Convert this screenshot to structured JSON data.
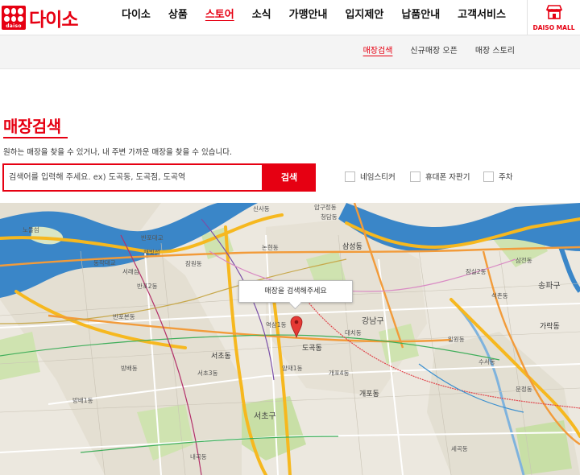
{
  "header": {
    "logo_text": "다이소",
    "logo_small": "daiso",
    "nav": [
      {
        "label": "다이소",
        "active": false
      },
      {
        "label": "상품",
        "active": false
      },
      {
        "label": "스토어",
        "active": true
      },
      {
        "label": "소식",
        "active": false
      },
      {
        "label": "가맹안내",
        "active": false
      },
      {
        "label": "입지제안",
        "active": false
      },
      {
        "label": "납품안내",
        "active": false
      },
      {
        "label": "고객서비스",
        "active": false
      }
    ],
    "mall_label": "DAISO MALL"
  },
  "subnav": [
    {
      "label": "매장검색",
      "active": true
    },
    {
      "label": "신규매장 오픈",
      "active": false
    },
    {
      "label": "매장 스토리",
      "active": false
    }
  ],
  "main": {
    "title": "매장검색",
    "description": "원하는 매장을 찾을 수 있거나, 내 주변 가까운 매장을 찾을 수 있습니다.",
    "search_placeholder": "검색어를 입력해 주세요. ex) 도곡동, 도곡점, 도곡역",
    "search_button": "검색",
    "filters": [
      {
        "label": "네임스티커",
        "checked": false
      },
      {
        "label": "휴대폰 자판기",
        "checked": false
      },
      {
        "label": "주차",
        "checked": false
      }
    ]
  },
  "map": {
    "tooltip": "매장을 검색해주세요",
    "labels": {
      "l1": "노들섬",
      "l2": "동작대교",
      "l3": "반포대교",
      "l4": "채빛섬",
      "l5": "서래섬",
      "l6": "반포2동",
      "l7": "반포본동",
      "l8": "신사동",
      "l9": "압구정동",
      "l10": "청담동",
      "l11": "논현동",
      "l12": "삼성동",
      "l13": "서초동",
      "l14": "강남구",
      "l15": "도곡동",
      "l16": "대치동",
      "l17": "개포동",
      "l18": "서초구",
      "l19": "송파구",
      "l20": "가락동",
      "l21": "양재1동",
      "l22": "역삼1동",
      "l23": "방배동",
      "l24": "잠원동",
      "l25": "서초3동",
      "l26": "삼전동",
      "l27": "잠실2동",
      "l28": "일원동",
      "l29": "수서동",
      "l30": "석촌동",
      "l31": "내곡동",
      "l32": "세곡동",
      "l33": "문정동",
      "l34": "개포4동",
      "l35": "방배1동"
    }
  }
}
